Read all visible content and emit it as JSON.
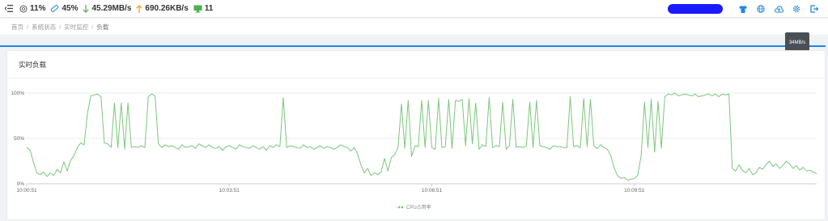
{
  "topbar": {
    "cpu": "11%",
    "memory": "45%",
    "download": "45.29MB/s",
    "upload": "690.26KB/s",
    "connections": "11",
    "colors": {
      "download": "#4caf50",
      "upload": "#ff9800",
      "connections": "#4caf50",
      "icons": "#1e88e5"
    }
  },
  "breadcrumb": [
    "首页",
    "系统状态",
    "实时监控",
    "负载"
  ],
  "tooltip": "34MB/s",
  "panel": {
    "title": "实时负载"
  },
  "chart_data": {
    "type": "line",
    "ylabel": "",
    "xlabel": "",
    "ylim": [
      0,
      100
    ],
    "y_ticks": [
      "0%",
      "50%",
      "100%"
    ],
    "x_ticks": [
      "10:00:51",
      "10:03:51",
      "10:06:51",
      "10:09:51"
    ],
    "grid": "horizontal",
    "legend": "bottom-center",
    "series": [
      {
        "name": "CPU占用率",
        "color": "#7bc77b",
        "values": [
          40,
          37,
          24,
          12,
          10,
          13,
          8,
          12,
          9,
          16,
          12,
          24,
          14,
          26,
          31,
          40,
          45,
          43,
          78,
          97,
          98,
          99,
          96,
          45,
          44,
          40,
          89,
          40,
          89,
          38,
          89,
          40,
          41,
          40,
          42,
          40,
          96,
          99,
          97,
          44,
          40,
          43,
          41,
          42,
          40,
          38,
          43,
          40,
          41,
          42,
          39,
          44,
          42,
          40,
          43,
          40,
          39,
          41,
          37,
          41,
          42,
          40,
          38,
          43,
          41,
          40,
          39,
          42,
          40,
          38,
          41,
          37,
          42,
          40,
          43,
          41,
          95,
          40,
          42,
          41,
          40,
          39,
          43,
          40,
          41,
          38,
          40,
          42,
          39,
          41,
          40,
          38,
          40,
          43,
          41,
          40,
          36,
          40,
          33,
          21,
          12,
          17,
          9,
          12,
          10,
          13,
          28,
          14,
          29,
          32,
          40,
          88,
          39,
          92,
          30,
          42,
          41,
          92,
          40,
          92,
          40,
          38,
          94,
          40,
          41,
          93,
          39,
          92,
          91,
          93,
          42,
          94,
          44,
          89,
          38,
          43,
          41,
          95,
          40,
          42,
          41,
          90,
          38,
          42,
          93,
          40,
          41,
          40,
          42,
          90,
          40,
          92,
          42,
          41,
          40,
          38,
          42,
          41,
          41,
          40,
          40,
          96,
          41,
          42,
          40,
          94,
          41,
          93,
          42,
          39,
          43,
          40,
          38,
          31,
          18,
          9,
          6,
          7,
          4,
          5,
          6,
          9,
          31,
          90,
          40,
          93,
          35,
          91,
          39,
          96,
          99,
          98,
          100,
          97,
          98,
          99,
          98,
          97,
          99,
          96,
          97,
          98,
          99,
          97,
          99,
          96,
          99,
          98,
          99,
          17,
          14,
          21,
          15,
          12,
          17,
          10,
          12,
          18,
          16,
          21,
          25,
          19,
          22,
          17,
          20,
          25,
          22,
          17,
          20,
          15,
          18,
          14,
          15,
          13,
          11
        ]
      }
    ]
  }
}
